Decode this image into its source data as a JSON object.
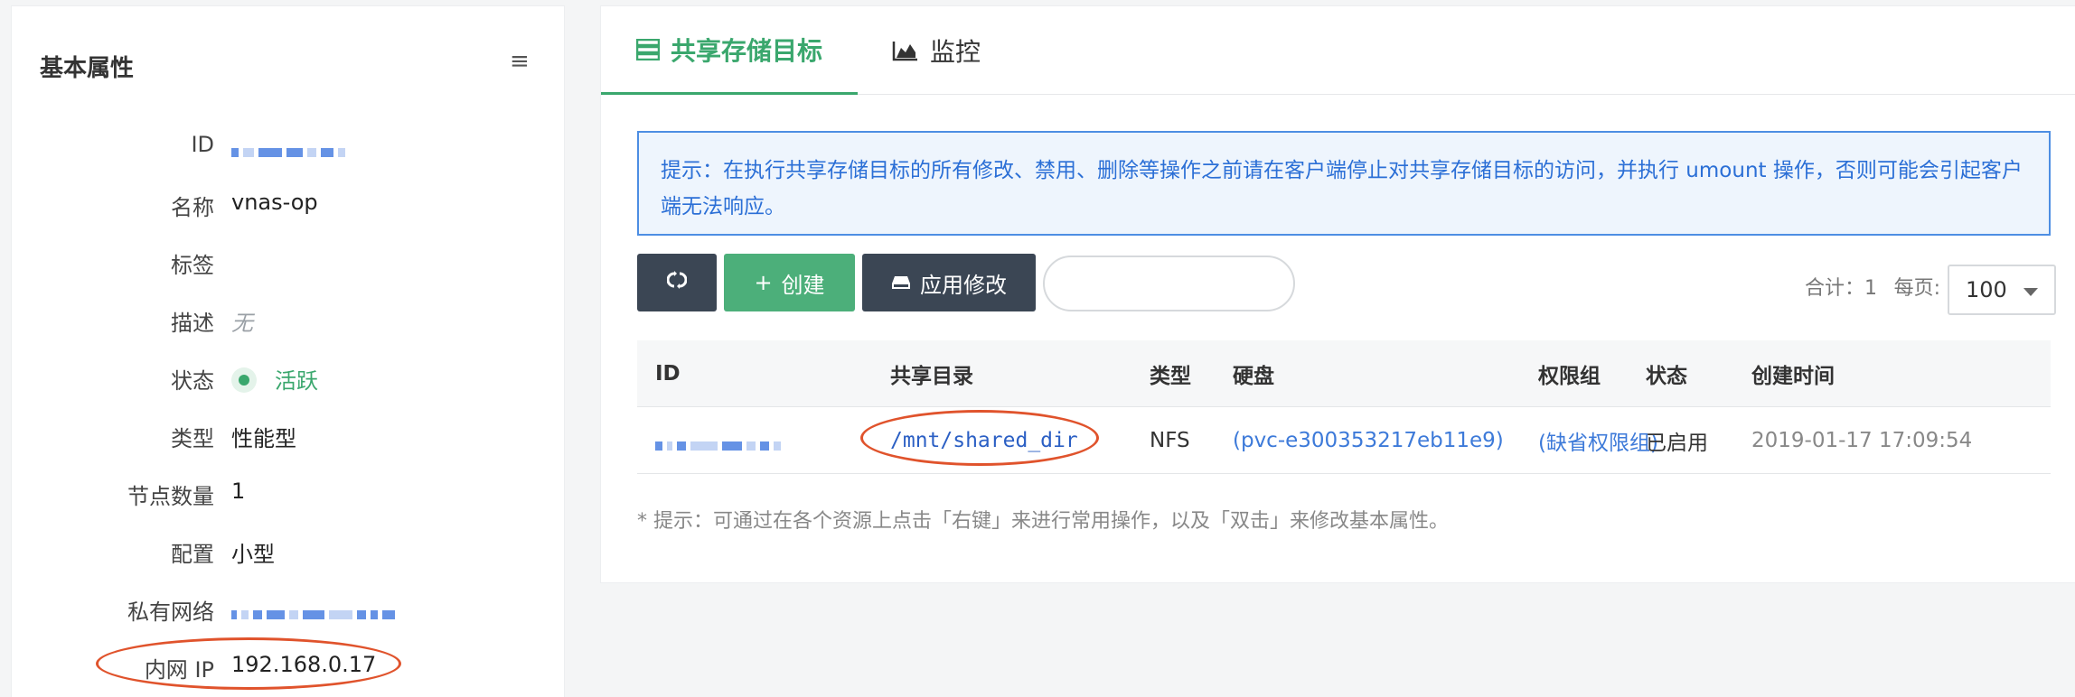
{
  "left_panel": {
    "title": "基本属性",
    "menu_icon": "hamburger-menu-icon",
    "props": {
      "id_label": "ID",
      "name_label": "名称",
      "name_value": "vnas-op",
      "tags_label": "标签",
      "desc_label": "描述",
      "desc_value": "无",
      "status_label": "状态",
      "status_value": "活跃",
      "type_label": "类型",
      "type_value": "性能型",
      "nodes_label": "节点数量",
      "nodes_value": "1",
      "config_label": "配置",
      "config_value": "小型",
      "vpc_label": "私有网络",
      "ip_label": "内网 IP",
      "ip_value": "192.168.0.17"
    }
  },
  "tabs": [
    {
      "label": "共享存储目标",
      "icon": "storage-icon",
      "active": true
    },
    {
      "label": "监控",
      "icon": "area-chart-icon",
      "active": false
    }
  ],
  "notice": "提示：在执行共享存储目标的所有修改、禁用、删除等操作之前请在客户端停止对共享存储目标的访问，并执行 umount 操作，否则可能会引起客户端无法响应。",
  "toolbar": {
    "refresh_icon": "refresh-icon",
    "create_label": "创建",
    "apply_label": "应用修改",
    "search_placeholder": "",
    "total": "合计：1",
    "per_page_label": "每页:",
    "per_page_value": "100"
  },
  "table": {
    "headers": {
      "id": "ID",
      "dir": "共享目录",
      "type": "类型",
      "disk": "硬盘",
      "perm": "权限组",
      "state": "状态",
      "time": "创建时间"
    },
    "rows": [
      {
        "dir": "/mnt/shared_dir",
        "type": "NFS",
        "disk": "(pvc-e300353217eb11e9)",
        "perm": "(缺省权限组)",
        "state": "已启用",
        "time": "2019-01-17 17:09:54"
      }
    ]
  },
  "hint": "* 提示：可通过在各个资源上点击「右键」来进行常用操作，以及「双击」来修改基本属性。",
  "colors": {
    "accent_green": "#3aa76d",
    "link_blue": "#3d7ad9",
    "dark_button": "#3b4654",
    "marker_red": "#e0532c"
  }
}
